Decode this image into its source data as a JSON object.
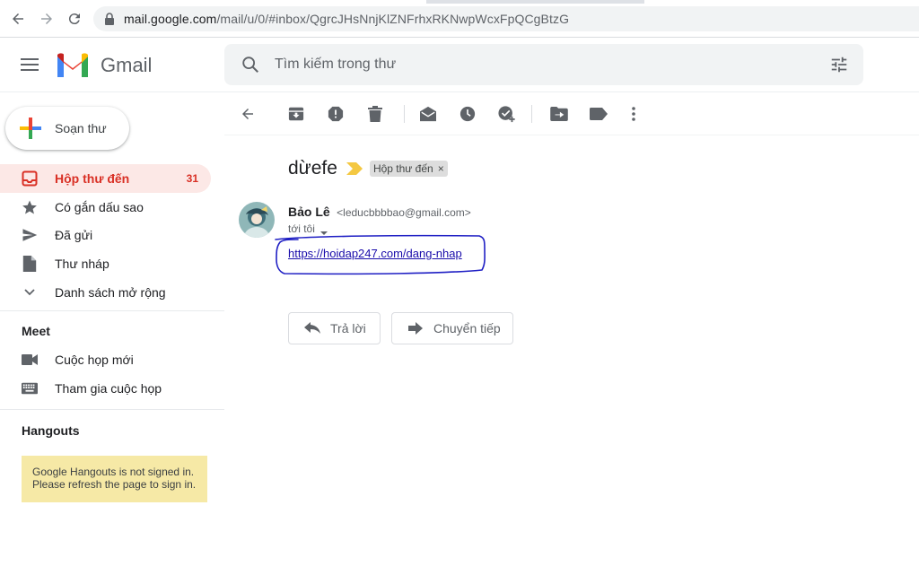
{
  "browser": {
    "url_host": "mail.google.com",
    "url_path": "/mail/u/0/#inbox/QgrcJHsNnjKlZNFrhxRKNwpWcxFpQCgBtzG"
  },
  "header": {
    "app_name": "Gmail",
    "search_placeholder": "Tìm kiếm trong thư"
  },
  "sidebar": {
    "compose_label": "Soạn thư",
    "items": [
      {
        "label": "Hộp thư đến",
        "count": "31",
        "icon": "inbox-icon"
      },
      {
        "label": "Có gắn dấu sao",
        "icon": "star-icon"
      },
      {
        "label": "Đã gửi",
        "icon": "send-icon"
      },
      {
        "label": "Thư nháp",
        "icon": "draft-icon"
      },
      {
        "label": "Danh sách mở rộng",
        "icon": "chevron-down-icon"
      }
    ],
    "meet_title": "Meet",
    "meet_items": [
      {
        "label": "Cuộc họp mới",
        "icon": "video-icon"
      },
      {
        "label": "Tham gia cuộc họp",
        "icon": "keyboard-icon"
      }
    ],
    "hangouts_title": "Hangouts",
    "hangouts_note_line1": "Google Hangouts is not signed in.",
    "hangouts_note_line2": "Please refresh the page to sign in."
  },
  "email": {
    "subject": "dừefe",
    "label": "Hộp thư đến",
    "sender_name": "Bảo Lê",
    "sender_email": "<leducbbbbao@gmail.com>",
    "to_text": "tới tôi",
    "link_text": "https://hoidap247.com/dang-nhap",
    "reply_label": "Trả lời",
    "forward_label": "Chuyển tiếp"
  },
  "colors": {
    "accent_red": "#d93025",
    "active_bg": "#fce8e6",
    "link": "#1a0dab",
    "note_bg": "#f6e9a6",
    "scribble": "#1f1fc4"
  }
}
